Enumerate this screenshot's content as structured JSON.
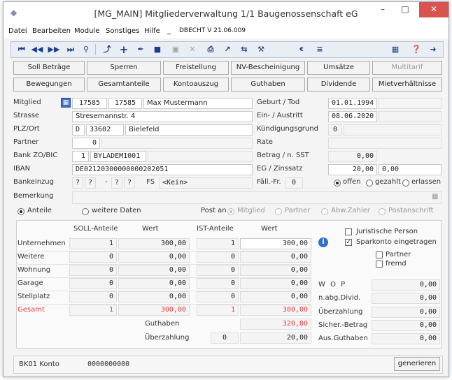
{
  "window": {
    "title": "[MG_MAIN] Mitgliederverwaltung  1/1  Baugenossenschaft eG",
    "minimize": "–",
    "maximize": "□",
    "close": "✕"
  },
  "menu": {
    "datei": "Datei",
    "bearbeiten": "Bearbeiten",
    "module": "Module",
    "sonstiges": "Sonstiges",
    "hilfe": "Hilfe",
    "sep": "_",
    "version": "DBECHT V 21.06.009"
  },
  "toolbar_icons": [
    "first-icon",
    "prev-icon",
    "next-icon",
    "last-icon",
    "search-icon",
    "pin-icon",
    "add-icon",
    "edit-icon",
    "delete-icon",
    "save-icon",
    "cancel-icon",
    "print-icon",
    "export-icon",
    "swap-icon",
    "tools-icon",
    "currency-icon",
    "calc-icon",
    "archive-icon",
    "help-icon",
    "exit-icon"
  ],
  "buttons_row1": [
    "Soll Beträge",
    "Sperren",
    "Freistellung",
    "NV-Bescheinigung",
    "Umsätze",
    "Multitarif"
  ],
  "buttons_row2": [
    "Bewegungen",
    "Gesamtanteile",
    "Kontoauszug",
    "Guthaben",
    "Dividende",
    "Mietverhältnisse"
  ],
  "member": {
    "mitglied_label": "Mitglied",
    "mitglied_no1": "17585",
    "mitglied_no2": "17585",
    "name": "Max Mustermann",
    "strasse_label": "Strasse",
    "strasse": "Stresemannstr. 4",
    "plz_label": "PLZ/Ort",
    "land": "D",
    "plz": "33602",
    "ort": "Bielefeld",
    "partner_label": "Partner",
    "partner": "0",
    "bank_label": "Bank ZO/BIC",
    "bank_no": "1",
    "bic": "BYLADEM1001",
    "iban_label": "IBAN",
    "iban": "DE02120300000000202051",
    "bankeinzug_label": "Bankeinzug",
    "bankeinzug_a": "?",
    "bankeinzug_b": "?",
    "bankeinzug_dash": "-",
    "bankeinzug_c": "?",
    "bankeinzug_d": "?",
    "fs_label": "FS",
    "fs_value": "<Kein>",
    "bemerkung_label": "Bemerkung",
    "geburt_label": "Geburt / Tod",
    "geburt": "01.01.1994",
    "eintritt_label": "Ein- / Austritt",
    "eintritt": "08.06.2020",
    "kuendigung_label": "Kündigungsgrund",
    "kuendigung": "0",
    "rate_label": "Rate",
    "betrag_label": "Betrag / n. SST",
    "betrag": "0,00",
    "eg_label": "EG / Zinssatz",
    "eg": "20,00",
    "zinssatz": "0,00",
    "faell_label": "Fäll.-Fr.",
    "faell": "0",
    "status_offen": "offen",
    "status_gezahlt": "gezahlt",
    "status_erlassen": "erlassen"
  },
  "tabs": {
    "anteile": "Anteile",
    "weitere": "weitere Daten",
    "post_an": "Post an",
    "mitglied": "Mitglied",
    "partner": "Partner",
    "abw": "Abw.Zahler",
    "postanschrift": "Postanschrift"
  },
  "anteile": {
    "headers": [
      "SOLL-Anteile",
      "Wert",
      "IST-Anteile",
      "Wert"
    ],
    "rows": [
      {
        "label": "Unternehmen",
        "soll": "1",
        "wert1": "300,00",
        "ist": "1",
        "wert2": "300,00"
      },
      {
        "label": "Weitere",
        "soll": "0",
        "wert1": "0,00",
        "ist": "0",
        "wert2": "0,00"
      },
      {
        "label": "Wohnung",
        "soll": "0",
        "wert1": "0,00",
        "ist": "0",
        "wert2": "0,00"
      },
      {
        "label": "Garage",
        "soll": "0",
        "wert1": "0,00",
        "ist": "0",
        "wert2": "0,00"
      },
      {
        "label": "Stellplatz",
        "soll": "0",
        "wert1": "0,00",
        "ist": "0",
        "wert2": "0,00"
      },
      {
        "label": "Gesamt",
        "soll": "1",
        "wert1": "300,00",
        "ist": "1",
        "wert2": "300,00"
      }
    ],
    "guthaben_label": "Guthaben",
    "guthaben": "320,00",
    "ueberzahlung_label": "Überzahlung",
    "ueberzahlung_count": "0",
    "ueberzahlung": "20,00"
  },
  "right": {
    "juristische": "Juristische Person",
    "sparkonto": "Sparkonto eingetragen",
    "partner": "Partner",
    "fremd": "fremd",
    "wop_label": "W O P",
    "wop": "0,00",
    "nabg_label": "n.abg.Divid.",
    "nabg": "0,00",
    "ueberz_label": "Überzahlung",
    "ueberz": "0,00",
    "sicher_label": "Sicher.-Betrag",
    "sicher": "0,00",
    "aus_label": "Aus.Guthaben",
    "aus": "0,00"
  },
  "footer": {
    "bk_label": "BK01 Konto",
    "bk_value": "0000000000",
    "generate": "generieren"
  },
  "colors": {
    "accent": "#1c3f8c",
    "red": "#e23b3b",
    "close": "#d9534f"
  }
}
